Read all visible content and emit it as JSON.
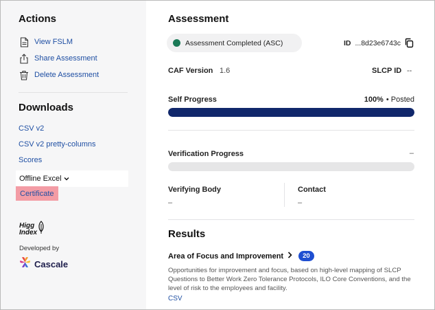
{
  "sidebar": {
    "actions_title": "Actions",
    "actions": [
      {
        "label": "View FSLM",
        "icon": "document-icon"
      },
      {
        "label": "Share Assessment",
        "icon": "share-icon"
      },
      {
        "label": "Delete Assessment",
        "icon": "trash-icon"
      }
    ],
    "downloads_title": "Downloads",
    "downloads": [
      "CSV v2",
      "CSV v2 pretty-columns",
      "Scores"
    ],
    "offline_excel": "Offline Excel",
    "certificate": "Certificate",
    "higg_logo_line1": "Higg",
    "higg_logo_line2": "Index",
    "developed_by": "Developed by",
    "cascale": "Cascale"
  },
  "assessment": {
    "title": "Assessment",
    "status": "Assessment Completed (ASC)",
    "status_color": "#1b7a57",
    "id_label": "ID",
    "id_value": "...8d23e6743c",
    "caf_label": "CAF Version",
    "caf_value": "1.6",
    "slcp_label": "SLCP ID",
    "slcp_value": "--",
    "self_progress_label": "Self Progress",
    "self_progress_value": "100%",
    "self_progress_fraction": 1.0,
    "self_progress_status": "• Posted",
    "verification_label": "Verification Progress",
    "verification_value": "–",
    "verification_fraction": 0,
    "verifying_body_label": "Verifying Body",
    "verifying_body_value": "–",
    "contact_label": "Contact",
    "contact_value": "–"
  },
  "results": {
    "title": "Results",
    "area_title": "Area of Focus and Improvement",
    "area_count": "20",
    "description": "Opportunities for improvement and focus, based on high-level mapping of SLCP Questions to Better Work Zero Tolerance Protocols, ILO Core Conventions, and the level of risk to the employees and facility.",
    "csv_link": "CSV"
  }
}
